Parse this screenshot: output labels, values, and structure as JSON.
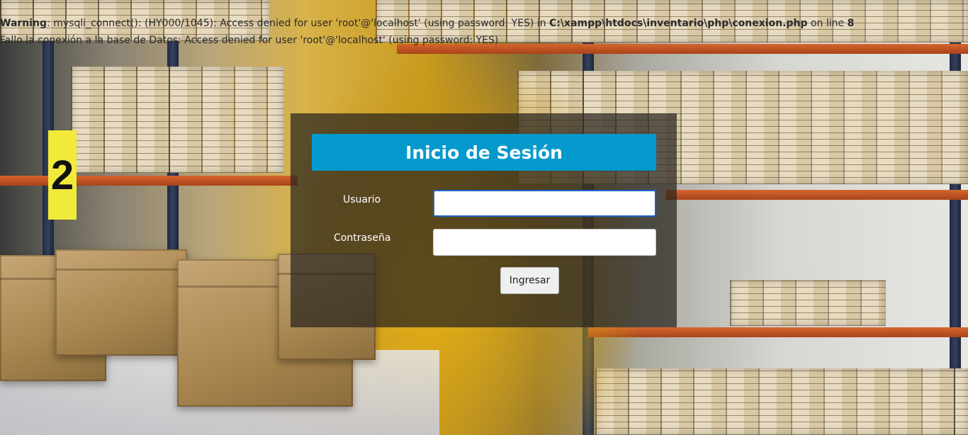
{
  "warning": {
    "label": "Warning",
    "message_before_path": ": mysqli_connect(): (HY000/1045): Access denied for user 'root'@'localhost' (using password: YES) in ",
    "path": "C:\\xampp\\htdocs\\inventario\\php\\conexion.php",
    "message_line_prefix": " on line ",
    "line": "8"
  },
  "error_message": "Fallo la conexión a la base de Datos: Access denied for user 'root'@'localhost' (using password: YES)",
  "login": {
    "title": "Inicio de Sesión",
    "username_label": "Usuario",
    "username_value": "",
    "password_label": "Contraseña",
    "password_value": "",
    "submit_label": "Ingresar"
  },
  "colors": {
    "title_bar": "#0499cc",
    "panel_overlay": "rgba(40,36,30,0.72)",
    "input_focus_border": "#1f63c8"
  }
}
